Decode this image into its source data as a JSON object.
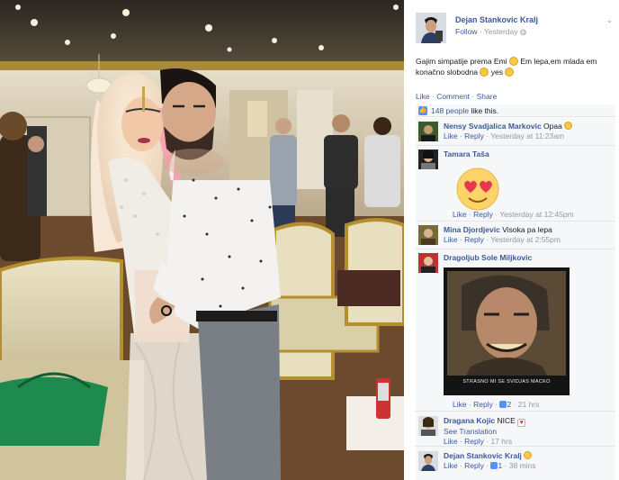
{
  "post": {
    "author": "Dejan Stankovic Kralj",
    "follow_label": "Follow",
    "timestamp": "Yesterday",
    "caption_part1": "Gajim simpatije prema Emi",
    "caption_part2": "Em lepa,em mlada em konačno slobodna",
    "caption_part3": "yes",
    "actions": {
      "like": "Like",
      "comment": "Comment",
      "share": "Share",
      "sep": "·"
    },
    "likes_count": "148 people",
    "likes_tail": "like this."
  },
  "comments": [
    {
      "name": "Nensy Svadjalica Markovic",
      "text": "Opaa",
      "like": "Like",
      "reply": "Reply",
      "time": "Yesterday at 11:23am"
    },
    {
      "name": "Tamara Taša",
      "text": "",
      "like": "Like",
      "reply": "Reply",
      "time": "Yesterday at 12:45pm"
    },
    {
      "name": "Mina Djordjevic",
      "text": "Visoka pa lepa",
      "like": "Like",
      "reply": "Reply",
      "time": "Yesterday at 2:55pm"
    },
    {
      "name": "Dragoljub Sole Miljkovic",
      "text": "",
      "photo_caption": "STRASNO MI SE SVIDJAS MACKO",
      "like": "Like",
      "reply": "Reply",
      "like_count": "2",
      "time": "21 hrs"
    },
    {
      "name": "Dragana Kojic",
      "text": "NICE",
      "see_translation": "See Translation",
      "like": "Like",
      "reply": "Reply",
      "time": "17 hrs"
    },
    {
      "name": "Dejan Stankovic Kralj",
      "text": "",
      "like": "Like",
      "reply": "Reply",
      "like_count": "1",
      "time": "38 mins"
    }
  ],
  "colors": {
    "link": "#3b5998",
    "meta": "#9197a3",
    "panel": "#f6f7f9",
    "like_blue": "#5890ff"
  },
  "icons": [
    "thumbs-up-icon",
    "globe-icon",
    "chevron-down-icon",
    "smiley-icon",
    "heart-eyes-sticker",
    "heart-icon"
  ]
}
